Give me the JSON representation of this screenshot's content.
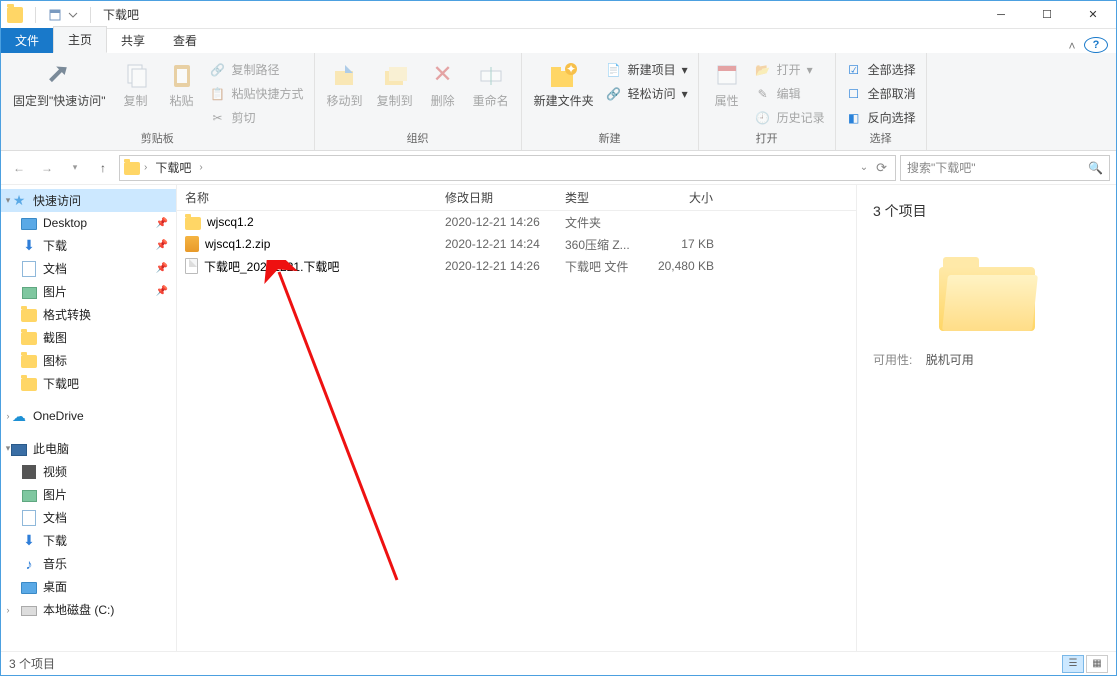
{
  "window": {
    "title": "下载吧"
  },
  "tabs": {
    "file": "文件",
    "home": "主页",
    "share": "共享",
    "view": "查看"
  },
  "ribbon": {
    "pin": "固定到\"快速访问\"",
    "copy": "复制",
    "paste": "粘贴",
    "copy_path": "复制路径",
    "paste_shortcut": "粘贴快捷方式",
    "cut": "剪切",
    "group_clipboard": "剪贴板",
    "move_to": "移动到",
    "copy_to": "复制到",
    "delete": "删除",
    "rename": "重命名",
    "group_organize": "组织",
    "new_folder": "新建文件夹",
    "new_item": "新建项目",
    "easy_access": "轻松访问",
    "group_new": "新建",
    "properties": "属性",
    "open": "打开",
    "edit": "编辑",
    "history": "历史记录",
    "group_open": "打开",
    "select_all": "全部选择",
    "select_none": "全部取消",
    "invert": "反向选择",
    "group_select": "选择"
  },
  "nav": {
    "crumb1": "下载吧",
    "refresh": "⟳",
    "search_placeholder": "搜索\"下载吧\""
  },
  "columns": {
    "name": "名称",
    "date": "修改日期",
    "type": "类型",
    "size": "大小"
  },
  "files": [
    {
      "name": "wjscq1.2",
      "date": "2020-12-21 14:26",
      "type": "文件夹",
      "size": "",
      "icon": "folder"
    },
    {
      "name": "wjscq1.2.zip",
      "date": "2020-12-21 14:24",
      "type": "360压缩 Z...",
      "size": "17 KB",
      "icon": "zip"
    },
    {
      "name": "下载吧_20201221.下载吧",
      "date": "2020-12-21 14:26",
      "type": "下载吧 文件",
      "size": "20,480 KB",
      "icon": "file"
    }
  ],
  "sidebar": {
    "quick": "快速访问",
    "items_quick": [
      "Desktop",
      "下载",
      "文档",
      "图片",
      "格式转换",
      "截图",
      "图标",
      "下载吧"
    ],
    "onedrive": "OneDrive",
    "thispc": "此电脑",
    "items_pc": [
      "视频",
      "图片",
      "文档",
      "下载",
      "音乐",
      "桌面",
      "本地磁盘 (C:)"
    ]
  },
  "details": {
    "count": "3 个项目",
    "avail_k": "可用性:",
    "avail_v": "脱机可用"
  },
  "status": {
    "text": "3 个项目"
  }
}
